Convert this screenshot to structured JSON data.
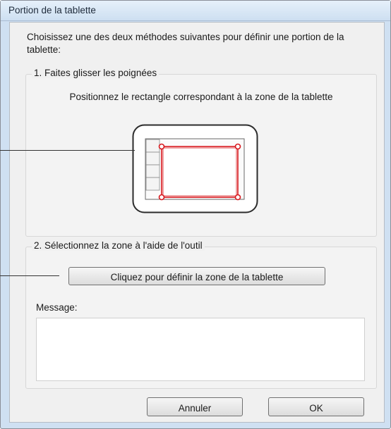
{
  "window": {
    "title": "Portion de la tablette"
  },
  "intro_text": "Choisissez une des deux méthodes suivantes pour définir une portion de la tablette:",
  "group1": {
    "label": "1. Faites glisser les poignées",
    "description": "Positionnez le rectangle correspondant à la zone de la tablette"
  },
  "group2": {
    "label": "2. Sélectionnez la zone à l'aide de l'outil",
    "define_button": "Cliquez pour définir la zone de la tablette",
    "message_label": "Message:",
    "message_value": ""
  },
  "buttons": {
    "cancel": "Annuler",
    "ok": "OK"
  },
  "colors": {
    "handle_red": "#d8191f",
    "tablet_outline": "#2b2b2b"
  }
}
